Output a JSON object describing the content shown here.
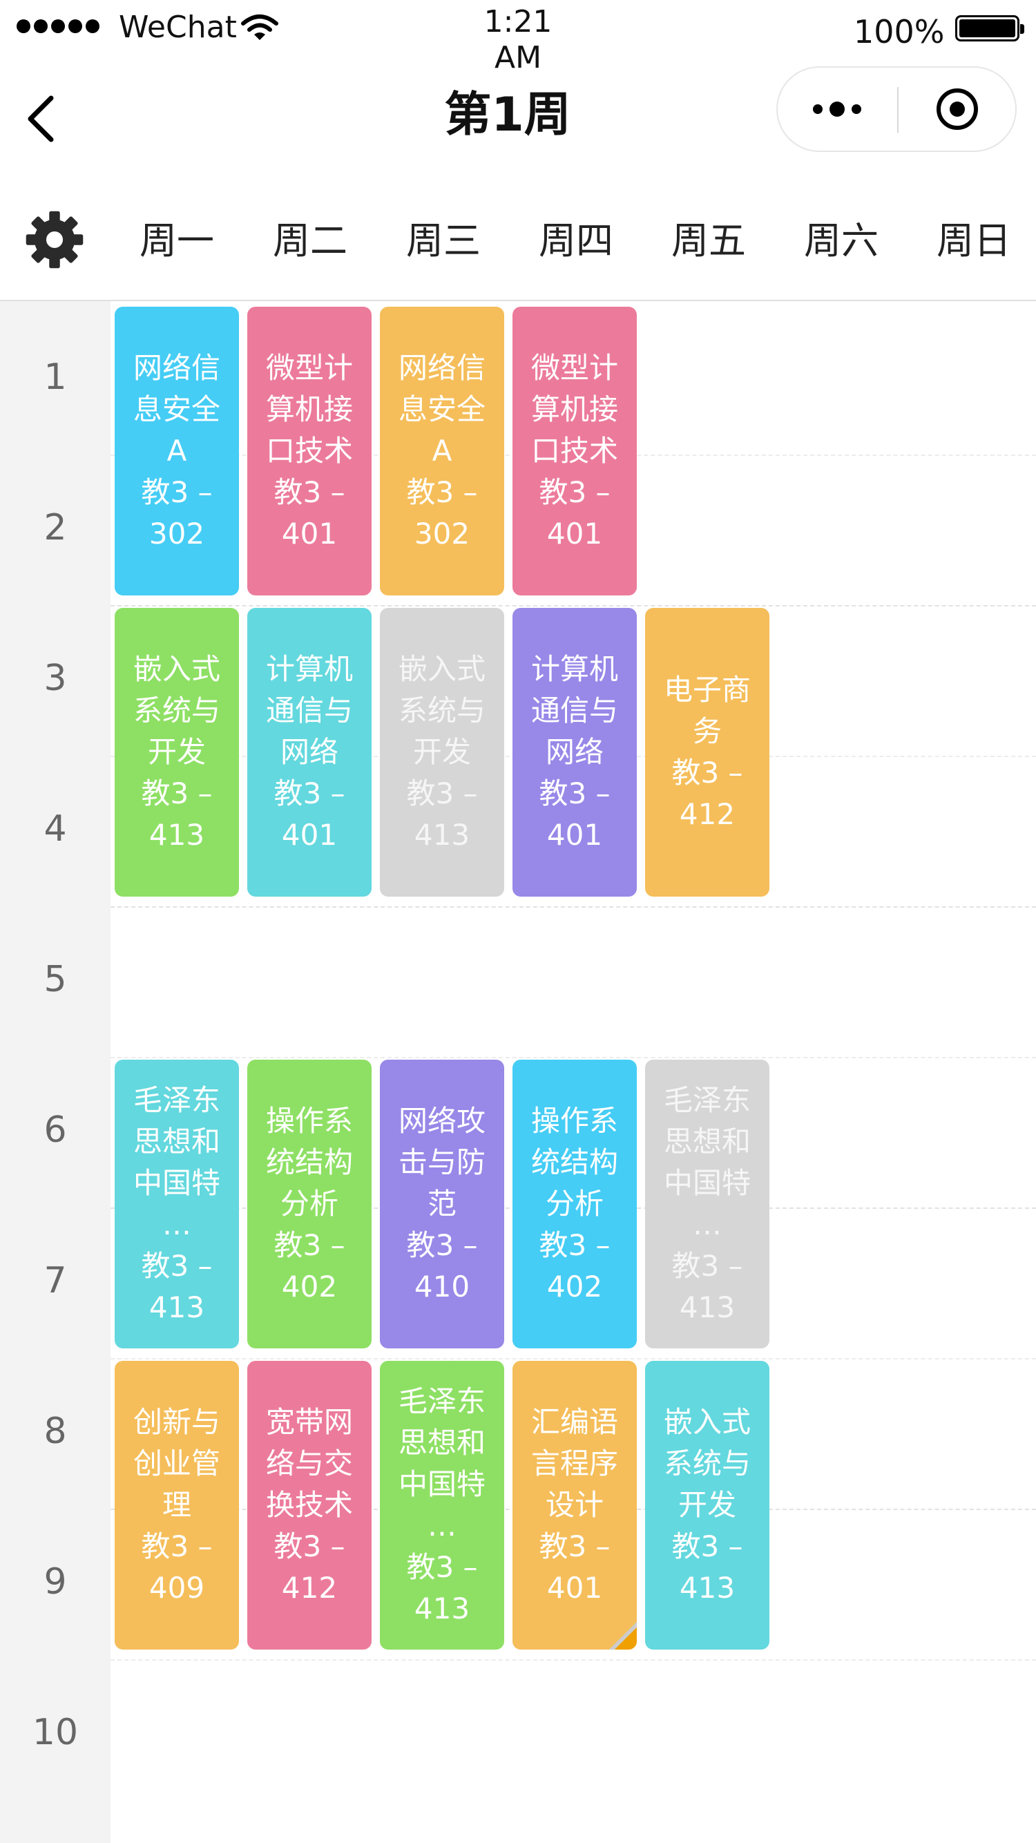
{
  "status_bar": {
    "carrier": "WeChat",
    "time": "1:21\nAM",
    "battery": "100%"
  },
  "nav": {
    "title": "第1周"
  },
  "week": {
    "days": [
      "周一",
      "周二",
      "周三",
      "周四",
      "周五",
      "周六",
      "周日"
    ]
  },
  "periods": [
    "1",
    "2",
    "3",
    "4",
    "5",
    "6",
    "7",
    "8",
    "9",
    "10"
  ],
  "colors": {
    "blue": "#45cdf5",
    "pink": "#ec7b9b",
    "orange": "#f5be5a",
    "green": "#8ee064",
    "teal": "#63d8de",
    "gray": "#d6d6d6",
    "purple": "#9888e8"
  },
  "courses": [
    {
      "day": 1,
      "start": 1,
      "name": "网络信\n息安全\nA",
      "room": "教3 –\n302",
      "color": "blue"
    },
    {
      "day": 2,
      "start": 1,
      "name": "微型计\n算机接\n口技术",
      "room": "教3 –\n401",
      "color": "pink"
    },
    {
      "day": 3,
      "start": 1,
      "name": "网络信\n息安全\nA",
      "room": "教3 –\n302",
      "color": "orange"
    },
    {
      "day": 4,
      "start": 1,
      "name": "微型计\n算机接\n口技术",
      "room": "教3 –\n401",
      "color": "pink"
    },
    {
      "day": 1,
      "start": 3,
      "name": "嵌入式\n系统与\n开发",
      "room": "教3 –\n413",
      "color": "green"
    },
    {
      "day": 2,
      "start": 3,
      "name": "计算机\n通信与\n网络",
      "room": "教3 –\n401",
      "color": "teal"
    },
    {
      "day": 3,
      "start": 3,
      "name": "嵌入式\n系统与\n开发",
      "room": "教3 –\n413",
      "color": "gray"
    },
    {
      "day": 4,
      "start": 3,
      "name": "计算机\n通信与\n网络",
      "room": "教3 –\n401",
      "color": "purple"
    },
    {
      "day": 5,
      "start": 3,
      "name": "电子商\n务",
      "room": "教3 –\n412",
      "color": "orange"
    },
    {
      "day": 1,
      "start": 6,
      "name": "毛泽东\n思想和\n中国特\n…",
      "room": "教3 –\n413",
      "color": "teal"
    },
    {
      "day": 2,
      "start": 6,
      "name": "操作系\n统结构\n分析",
      "room": "教3 –\n402",
      "color": "green"
    },
    {
      "day": 3,
      "start": 6,
      "name": "网络攻\n击与防\n范",
      "room": "教3 –\n410",
      "color": "purple"
    },
    {
      "day": 4,
      "start": 6,
      "name": "操作系\n统结构\n分析",
      "room": "教3 –\n402",
      "color": "blue"
    },
    {
      "day": 5,
      "start": 6,
      "name": "毛泽东\n思想和\n中国特\n…",
      "room": "教3 –\n413",
      "color": "gray"
    },
    {
      "day": 1,
      "start": 8,
      "name": "创新与\n创业管\n理",
      "room": "教3 –\n409",
      "color": "orange"
    },
    {
      "day": 2,
      "start": 8,
      "name": "宽带网\n络与交\n换技术",
      "room": "教3 –\n412",
      "color": "pink"
    },
    {
      "day": 3,
      "start": 8,
      "name": "毛泽东\n思想和\n中国特\n…",
      "room": "教3 –\n413",
      "color": "green"
    },
    {
      "day": 4,
      "start": 8,
      "name": "汇编语\n言程序\n设计",
      "room": "教3 –\n401",
      "color": "orange",
      "corner": true
    },
    {
      "day": 5,
      "start": 8,
      "name": "嵌入式\n系统与\n开发",
      "room": "教3 –\n413",
      "color": "teal"
    }
  ]
}
